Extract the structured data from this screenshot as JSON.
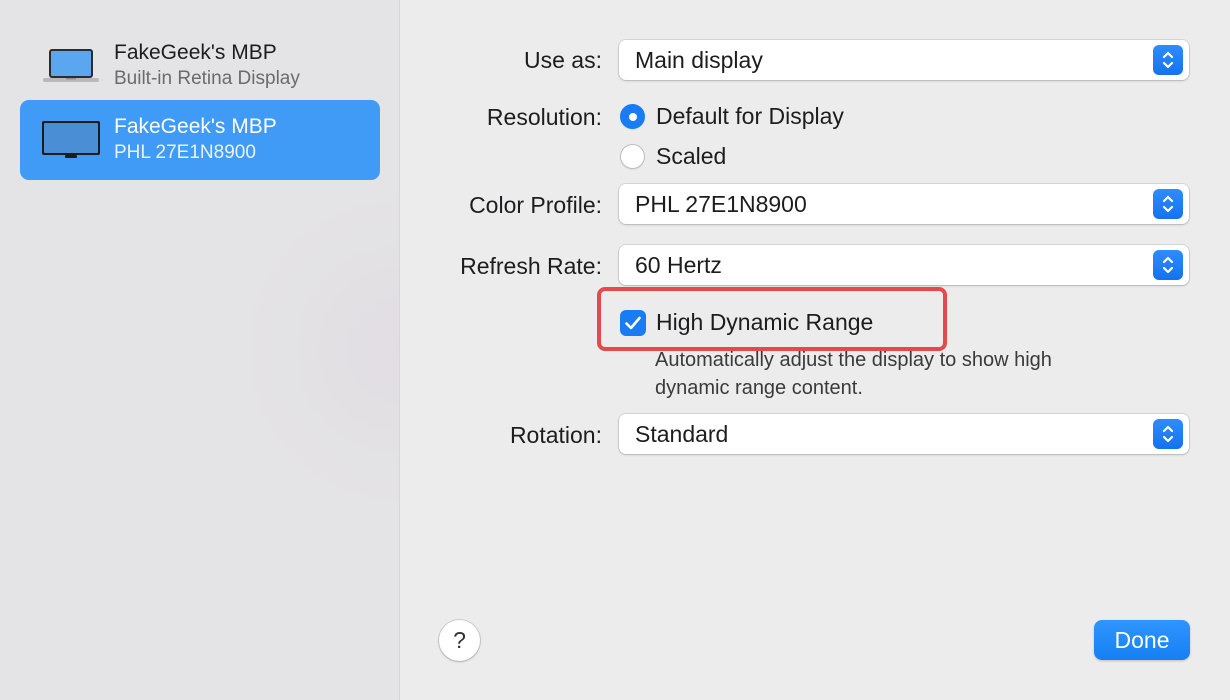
{
  "sidebar": {
    "displays": [
      {
        "name": "FakeGeek's MBP",
        "subtitle": "Built-in Retina Display",
        "selected": false,
        "icon": "laptop-icon"
      },
      {
        "name": "FakeGeek's MBP",
        "subtitle": "PHL 27E1N8900",
        "selected": true,
        "icon": "monitor-icon"
      }
    ]
  },
  "settings": {
    "use_as": {
      "label": "Use as:",
      "value": "Main display"
    },
    "resolution": {
      "label": "Resolution:",
      "options": [
        {
          "label": "Default for Display",
          "selected": true
        },
        {
          "label": "Scaled",
          "selected": false
        }
      ]
    },
    "color_profile": {
      "label": "Color Profile:",
      "value": "PHL 27E1N8900"
    },
    "refresh_rate": {
      "label": "Refresh Rate:",
      "value": "60 Hertz"
    },
    "hdr": {
      "label": "High Dynamic Range",
      "checked": true,
      "description_line1": "Automatically adjust the display to show high",
      "description_line2": "dynamic range content."
    },
    "rotation": {
      "label": "Rotation:",
      "value": "Standard"
    }
  },
  "footer": {
    "help_label": "?",
    "done_label": "Done"
  },
  "colors": {
    "accent": "#1a7cf3",
    "selected_row": "#3f9bf6",
    "highlight": "#e5484d"
  }
}
